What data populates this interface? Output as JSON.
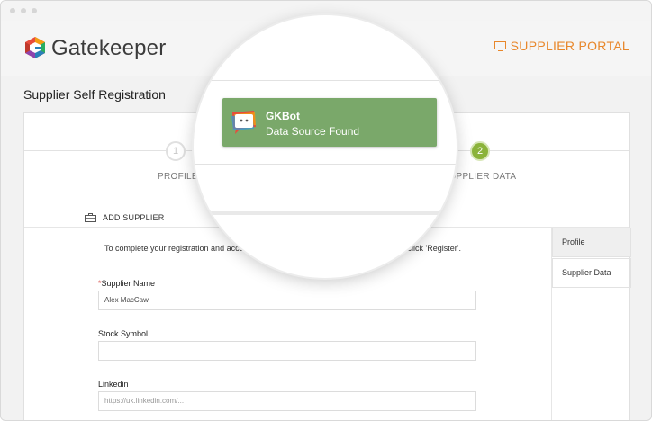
{
  "header": {
    "brand": "Gatekeeper",
    "portal_label": "SUPPLIER PORTAL",
    "portal_icon": "monitor-icon",
    "accent": "#e8872b"
  },
  "page": {
    "title": "Supplier Self Registration"
  },
  "steps": [
    {
      "number": "1",
      "label": "PROFILE",
      "active": false
    },
    {
      "number": "2",
      "label": "SUPPLIER DATA",
      "active": true
    }
  ],
  "section": {
    "title": "ADD SUPPLIER",
    "icon": "briefcase-icon"
  },
  "instruction": {
    "left": "To complete your registration and access",
    "right": "nd click 'Register'."
  },
  "sidebar": {
    "tabs": [
      {
        "label": "Profile",
        "active": true
      },
      {
        "label": "Supplier Data",
        "active": false
      }
    ]
  },
  "form": {
    "supplier_name": {
      "label": "Supplier Name",
      "required_mark": "*",
      "value": "Alex MacCaw"
    },
    "stock_symbol": {
      "label": "Stock Symbol",
      "value": ""
    },
    "linkedin": {
      "label": "Linkedin",
      "placeholder": "https://uk.linkedin.com/..."
    }
  },
  "toast": {
    "title": "GKBot",
    "message": "Data Source Found",
    "color": "#7aa86a"
  },
  "colors": {
    "step_active": "#8bb33a",
    "required": "#d9534f"
  }
}
